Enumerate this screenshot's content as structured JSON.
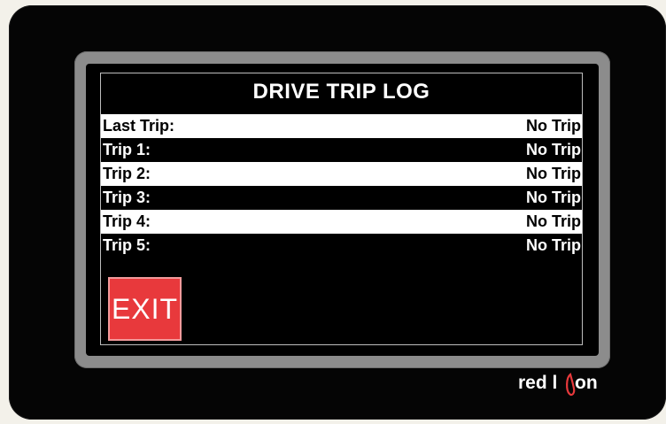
{
  "screen": {
    "title": "DRIVE TRIP LOG",
    "rows": [
      {
        "label": "Last Trip:",
        "value": "No Trip"
      },
      {
        "label": "Trip 1:",
        "value": "No Trip"
      },
      {
        "label": "Trip 2:",
        "value": "No Trip"
      },
      {
        "label": "Trip 3:",
        "value": "No Trip"
      },
      {
        "label": "Trip 4:",
        "value": "No Trip"
      },
      {
        "label": "Trip 5:",
        "value": "No Trip"
      }
    ],
    "exit_label": "EXIT"
  },
  "branding": {
    "logo_text": "red lion",
    "accent": "#e8393c"
  }
}
